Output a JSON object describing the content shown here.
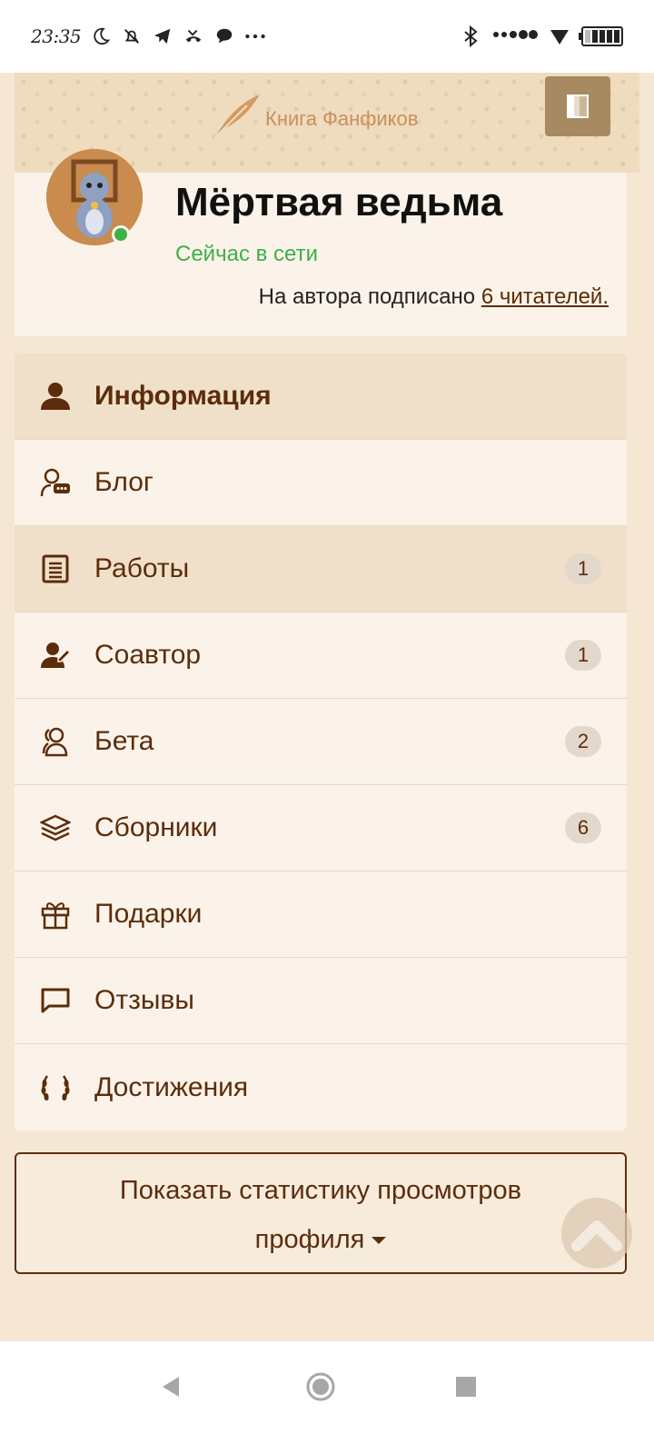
{
  "status_bar": {
    "time": "23:35",
    "icons": [
      "moon-icon",
      "bell-off-icon",
      "telegram-icon",
      "missed-call-icon",
      "chat-icon",
      "more-dots-icon"
    ],
    "right_icons": [
      "bluetooth-icon",
      "signal-dots-icon",
      "wifi-icon",
      "battery-icon"
    ]
  },
  "header": {
    "logo_text": "Книга Фанфиков",
    "logo_icon": "feather-icon",
    "menu_icon": "book-menu-icon"
  },
  "profile": {
    "name": "Мёртвая ведьма",
    "status": "Сейчас в сети",
    "subscribers_prefix": "На автора подписано ",
    "subscribers_link": "6 читателей.",
    "avatar": "cat-avatar"
  },
  "nav": {
    "items": [
      {
        "label": "Информация",
        "icon": "user-icon",
        "badge": ""
      },
      {
        "label": "Блог",
        "icon": "blog-user-icon",
        "badge": ""
      },
      {
        "label": "Работы",
        "icon": "document-icon",
        "badge": "1"
      },
      {
        "label": "Соавтор",
        "icon": "coauthor-icon",
        "badge": "1"
      },
      {
        "label": "Бета",
        "icon": "beta-users-icon",
        "badge": "2"
      },
      {
        "label": "Сборники",
        "icon": "layers-icon",
        "badge": "6"
      },
      {
        "label": "Подарки",
        "icon": "gift-icon",
        "badge": ""
      },
      {
        "label": "Отзывы",
        "icon": "comment-icon",
        "badge": ""
      },
      {
        "label": "Достижения",
        "icon": "laurel-icon",
        "badge": ""
      }
    ]
  },
  "stats_button": {
    "line1": "Показать статистику просмотров",
    "line2": "профиля"
  },
  "colors": {
    "accent_brown": "#5b2d0a",
    "online_green": "#3db048",
    "page_bg": "#f5e7d3",
    "card_bg": "#fbf3ea",
    "active_bg": "#f0e0c9"
  }
}
